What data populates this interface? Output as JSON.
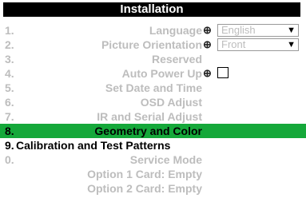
{
  "menu": {
    "title": "Installation",
    "rows": [
      {
        "num": "1.",
        "label": "Language",
        "value": "English"
      },
      {
        "num": "2.",
        "label": "Picture Orientation",
        "value": "Front"
      },
      {
        "num": "3.",
        "label": "Reserved"
      },
      {
        "num": "4.",
        "label": "Auto Power Up"
      },
      {
        "num": "5.",
        "label": "Set Date and Time"
      },
      {
        "num": "6.",
        "label": "OSD Adjust"
      },
      {
        "num": "7.",
        "label": "IR and Serial Adjust"
      },
      {
        "num": "8.",
        "label": "Geometry and Color"
      },
      {
        "num": "9.",
        "label": "Calibration and Test Patterns"
      },
      {
        "num": "0.",
        "label": "Service Mode"
      },
      {
        "num": "",
        "label": "Option 1 Card: Empty"
      },
      {
        "num": "",
        "label": "Option 2 Card: Empty"
      }
    ]
  },
  "icons": {
    "lock": "lock-icon",
    "dropdown": "chevron-down-icon",
    "checkbox": "checkbox"
  }
}
